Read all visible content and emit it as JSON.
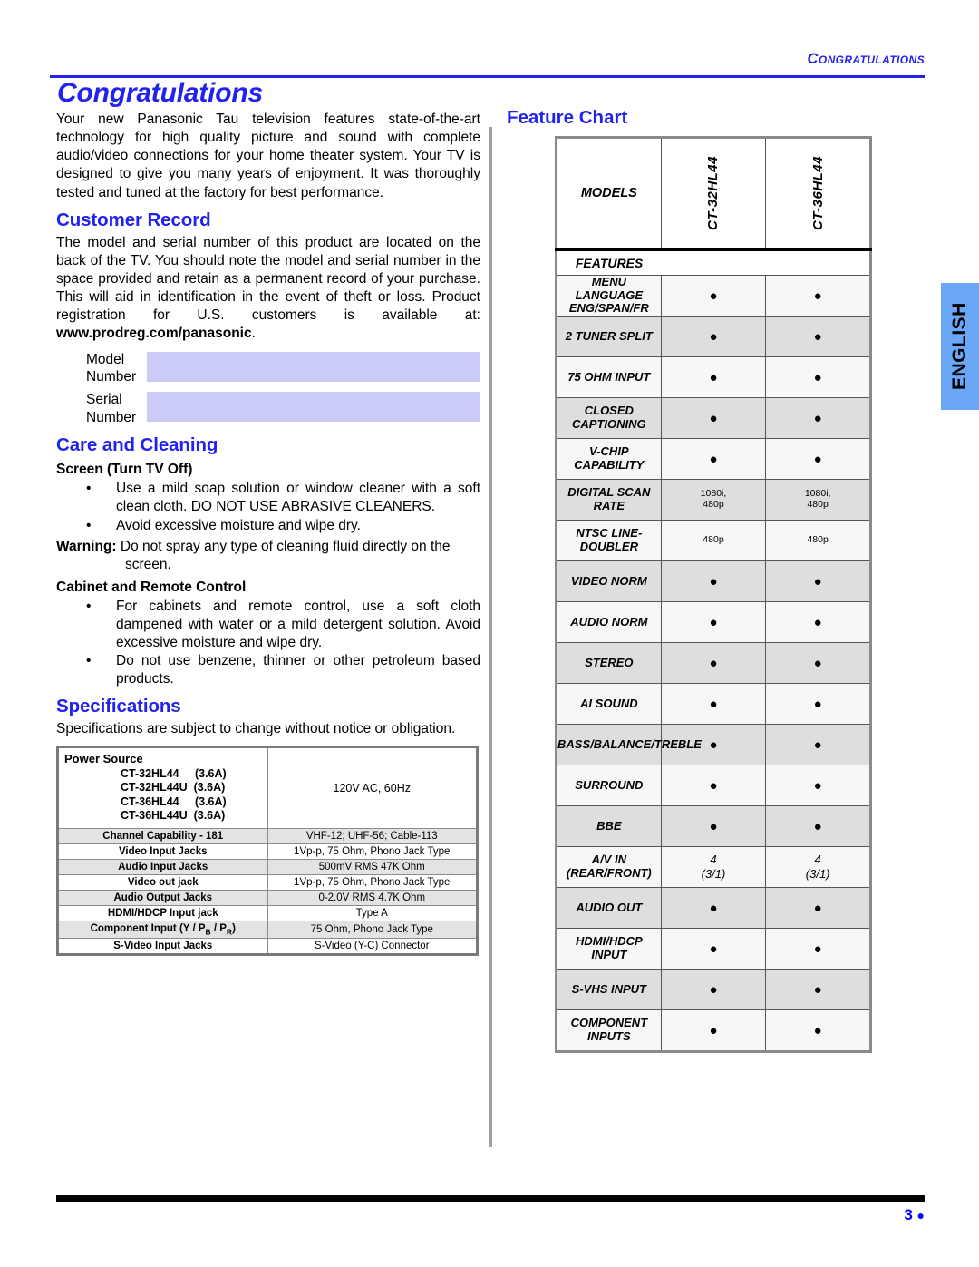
{
  "running_head": "Congratulations",
  "page_title": "Congratulations",
  "intro": "Your new Panasonic Tau television features state-of-the-art technology for high quality picture and sound with complete audio/video connections for your home theater system. Your TV is designed to give you many years of enjoyment. It was thoroughly tested and tuned at the factory for best performance.",
  "customer_record": {
    "heading": "Customer Record",
    "body_before_link": "The model and serial number of this product are located on the back of the TV. You should note the model and serial number in the space provided and retain as a permanent record of your purchase. This will aid in identification in the event of theft or loss. Product registration for U.S. customers is available at: ",
    "link": "www.prodreg.com/panasonic",
    "body_after_link": ".",
    "fields": [
      {
        "label_line1": "Model",
        "label_line2": "Number",
        "value": ""
      },
      {
        "label_line1": "Serial",
        "label_line2": "Number",
        "value": ""
      }
    ],
    "field_fill_color": "#CBCBF8"
  },
  "care_and_cleaning": {
    "heading": "Care and Cleaning",
    "screen_heading": "Screen (Turn TV Off)",
    "screen_bullets": [
      "Use a mild soap solution or window cleaner with a soft clean cloth. DO NOT USE ABRASIVE CLEANERS.",
      "Avoid excessive moisture and wipe dry."
    ],
    "warning_label": "Warning:",
    "warning_text": " Do not spray any type of cleaning fluid directly on the",
    "warning_text2": "screen.",
    "cabinet_heading": "Cabinet and Remote Control",
    "cabinet_bullets": [
      "For cabinets and remote control, use a soft cloth dampened with water or a mild detergent solution. Avoid excessive moisture and wipe dry.",
      "Do not use benzene, thinner or other petroleum based products."
    ]
  },
  "specifications": {
    "heading": "Specifications",
    "intro": "Specifications are subject to change without notice or obligation.",
    "power_source_label": "Power Source",
    "power_source_models": "CT-32HL44     (3.6A)\nCT-32HL44U  (3.6A)\nCT-36HL44     (3.6A)\nCT-36HL44U  (3.6A)",
    "power_source_value": "120V AC, 60Hz",
    "rows": [
      {
        "key": "Channel Capability - 181",
        "value": "VHF-12; UHF-56; Cable-113"
      },
      {
        "key": "Video Input Jacks",
        "value": "1Vp-p, 75 Ohm, Phono Jack Type"
      },
      {
        "key": "Audio Input Jacks",
        "value": "500mV RMS 47K Ohm"
      },
      {
        "key": "Video out jack",
        "value": "1Vp-p, 75 Ohm, Phono Jack Type"
      },
      {
        "key": "Audio Output Jacks",
        "value": "0-2.0V RMS 4.7K Ohm"
      },
      {
        "key": "HDMI/HDCP Input jack",
        "value": "Type A"
      },
      {
        "key": "Component Input (Y / P<sub>B</sub> / P<sub>R</sub>)",
        "value": "75 Ohm, Phono Jack Type"
      },
      {
        "key": "S-Video Input Jacks",
        "value": "S-Video (Y-C) Connector"
      }
    ]
  },
  "feature_chart": {
    "heading": "Feature Chart",
    "models_label": "MODELS",
    "model_columns": [
      "CT-32HL44",
      "CT-36HL44"
    ],
    "features_label": "FEATURES",
    "rows": [
      {
        "name": "MENU LANGUAGE\nENG/SPAN/FR",
        "col1": "dot",
        "col2": "dot"
      },
      {
        "name": "2 TUNER SPLIT",
        "col1": "dot",
        "col2": "dot"
      },
      {
        "name": "75 OHM INPUT",
        "col1": "dot",
        "col2": "dot"
      },
      {
        "name": "CLOSED CAPTIONING",
        "col1": "dot",
        "col2": "dot"
      },
      {
        "name": "V-CHIP CAPABILITY",
        "col1": "dot",
        "col2": "dot"
      },
      {
        "name": "DIGITAL SCAN RATE",
        "col1": "1080i,\n480p",
        "col2": "1080i,\n480p"
      },
      {
        "name": "NTSC LINE-DOUBLER",
        "col1": "480p",
        "col2": "480p"
      },
      {
        "name": "VIDEO NORM",
        "col1": "dot",
        "col2": "dot"
      },
      {
        "name": "AUDIO NORM",
        "col1": "dot",
        "col2": "dot"
      },
      {
        "name": "STEREO",
        "col1": "dot",
        "col2": "dot"
      },
      {
        "name": "AI SOUND",
        "col1": "dot",
        "col2": "dot"
      },
      {
        "name": "BASS/BALANCE/TREBLE",
        "col1": "dot",
        "col2": "dot"
      },
      {
        "name": "SURROUND",
        "col1": "dot",
        "col2": "dot"
      },
      {
        "name": "BBE",
        "col1": "dot",
        "col2": "dot"
      },
      {
        "name": "A/V IN (REAR/FRONT)",
        "col1": "4\n(3/1)",
        "col2": "4\n(3/1)"
      },
      {
        "name": "AUDIO OUT",
        "col1": "dot",
        "col2": "dot"
      },
      {
        "name": "HDMI/HDCP INPUT",
        "col1": "dot",
        "col2": "dot"
      },
      {
        "name": "S-VHS INPUT",
        "col1": "dot",
        "col2": "dot"
      },
      {
        "name": "COMPONENT INPUTS",
        "col1": "dot",
        "col2": "dot"
      }
    ]
  },
  "language_tab": {
    "label": "ENGLISH",
    "color": "#6AA8F7"
  },
  "footer": {
    "page_number": "3",
    "bullet": "●",
    "color": "#0000EE"
  },
  "accent_color": "#2222EE"
}
